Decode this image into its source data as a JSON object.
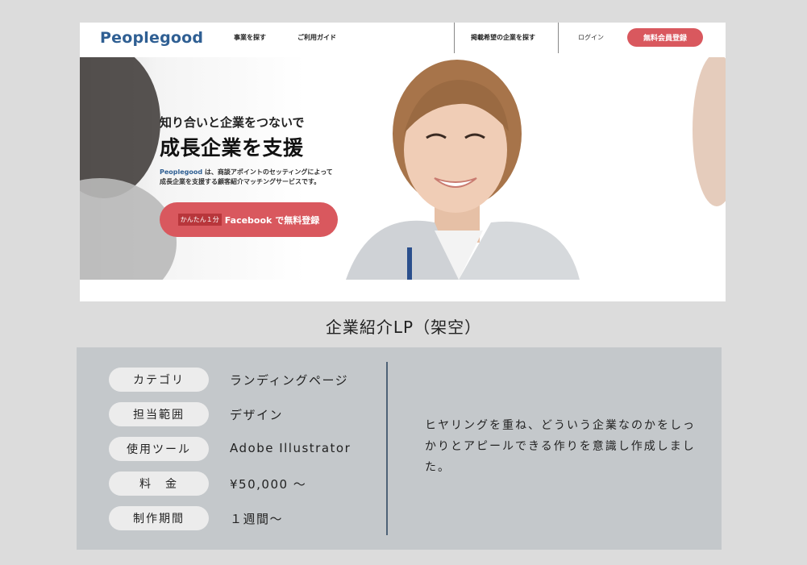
{
  "lp": {
    "logo": "Peoplegood",
    "nav": {
      "find_business": "事業を探す",
      "guide": "ご利用ガイド",
      "find_companies": "掲載希望の企業を探す",
      "login": "ログイン",
      "register": "無料会員登録"
    },
    "hero": {
      "subtitle": "知り合いと企業をつないで",
      "title": "成長企業を支援",
      "desc_brand": "Peoplegood",
      "desc_line1": " は、商談アポイントのセッティングによって",
      "desc_line2": "成長企業を支援する顧客紹介マッチングサービスです。",
      "cta_badge": "かんたん１分",
      "cta_label": "Facebook で無料登録"
    },
    "colors": {
      "brand_blue": "#2f5f93",
      "cta_red": "#d9585e"
    }
  },
  "caption": "企業紹介LP（架空）",
  "details": {
    "rows": [
      {
        "label": "カテゴリ",
        "value": "ランディングページ"
      },
      {
        "label": "担当範囲",
        "value": "デザイン"
      },
      {
        "label": "使用ツール",
        "value": "Adobe Illustrator"
      },
      {
        "label": "料　金",
        "value": "¥50,000 ～"
      },
      {
        "label": "制作期間",
        "value": "１週間～"
      }
    ],
    "summary": "ヒヤリングを重ね、どういう企業なのかをしっかりとアピールできる作りを意識し作成しました。"
  }
}
